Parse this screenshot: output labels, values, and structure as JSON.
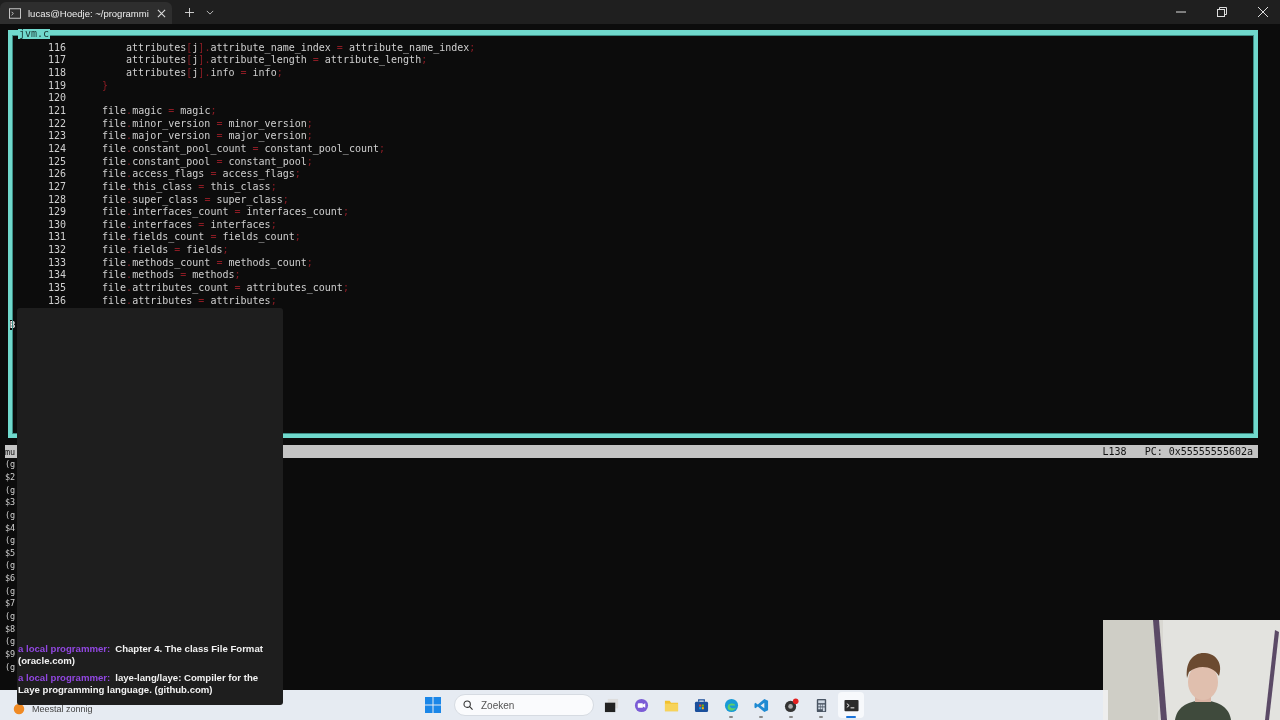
{
  "window": {
    "tab_title": "lucas@Hoedje: ~/programmi"
  },
  "source": {
    "filename": "jvm.c",
    "lines": [
      {
        "number": "116",
        "code": "    attributes[j].attribute_name_index = attribute_name_index;"
      },
      {
        "number": "117",
        "code": "    attributes[j].attribute_length = attribute_length;"
      },
      {
        "number": "118",
        "code": "    attributes[j].info = info;"
      },
      {
        "number": "119",
        "code": "}"
      },
      {
        "number": "120"
      },
      {
        "number": "121",
        "code": "file.magic = magic;"
      },
      {
        "number": "122",
        "code": "file.minor_version = minor_version;"
      },
      {
        "number": "123",
        "code": "file.major_version = major_version;"
      },
      {
        "number": "124",
        "code": "file.constant_pool_count = constant_pool_count;"
      },
      {
        "number": "125",
        "code": "file.constant_pool = constant_pool;"
      },
      {
        "number": "126",
        "code": "file.access_flags = access_flags;"
      },
      {
        "number": "127",
        "code": "file.this_class = this_class;"
      },
      {
        "number": "128",
        "code": "file.super_class = super_class;"
      },
      {
        "number": "129",
        "code": "file.interfaces_count = interfaces_count;"
      },
      {
        "number": "130",
        "code": "file.interfaces = interfaces;"
      },
      {
        "number": "131",
        "code": "file.fields_count = fields_count;"
      },
      {
        "number": "132",
        "code": "file.fields = fields;"
      },
      {
        "number": "133",
        "code": "file.methods_count = methods_count;"
      },
      {
        "number": "134",
        "code": "file.methods = methods;"
      },
      {
        "number": "135",
        "code": "file.attributes_count = attributes_count;"
      },
      {
        "number": "136",
        "code": "file.attributes = attributes;"
      }
    ],
    "current_line_marker": "B"
  },
  "status_line": {
    "left": "mu",
    "line": "L138",
    "pc": "PC: 0x55555555602a"
  },
  "gdb_output": [
    "(g",
    "$2",
    "(g",
    "$3",
    "(g",
    "$4",
    "(g",
    "$5",
    "(g",
    "$6",
    "(g",
    "$7",
    "(g",
    "$8",
    "(g",
    "$9",
    "(g"
  ],
  "chat": [
    {
      "author": "a local programmer:",
      "text": "Chapter 4. The class File Format (oracle.com)"
    },
    {
      "author": "a local programmer:",
      "text": "laye-lang/laye: Compiler for the Laye programming language. (github.com)"
    }
  ],
  "taskbar": {
    "weather": "Meestal zonnig",
    "search": {
      "placeholder": "Zoeken"
    },
    "apps": [
      {
        "kind": "taskview",
        "running": false,
        "selected": false
      },
      {
        "kind": "chat",
        "running": false,
        "selected": false
      },
      {
        "kind": "files",
        "running": false,
        "selected": false
      },
      {
        "kind": "store",
        "running": false,
        "selected": false
      },
      {
        "kind": "edge",
        "running": true,
        "selected": false
      },
      {
        "kind": "vscode",
        "running": true,
        "selected": false
      },
      {
        "kind": "recorder",
        "running": true,
        "selected": false
      },
      {
        "kind": "calculator",
        "running": true,
        "selected": false
      },
      {
        "kind": "terminal",
        "running": true,
        "selected": true
      }
    ]
  }
}
